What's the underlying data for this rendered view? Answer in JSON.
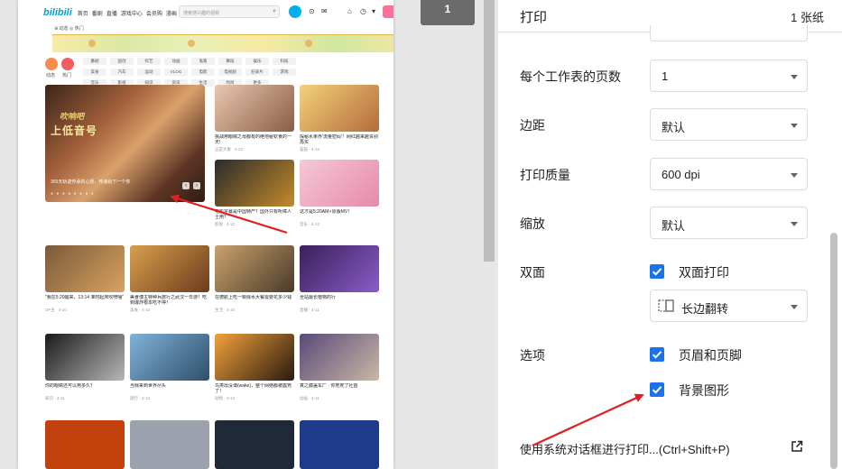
{
  "preview": {
    "page_number": "1",
    "site": {
      "logo": "bilibili",
      "nav": [
        "首页",
        "番剧",
        "直播",
        "游戏中心",
        "会员购",
        "漫画",
        "赛事"
      ],
      "search_placeholder": "搜索感兴趣的视频",
      "subnav": "⊕ 动态  ◎ 热门",
      "categories": [
        {
          "label": "动态",
          "color": "#f98b4b"
        },
        {
          "label": "热门",
          "color": "#f25d5d"
        }
      ],
      "tags": [
        "番剧",
        "国创",
        "综艺",
        "动画",
        "鬼畜",
        "舞蹈",
        "娱乐",
        "科技",
        "美食",
        "汽车",
        "运动",
        "VLOG",
        "电影",
        "电视剧",
        "纪录片",
        "游戏",
        "音乐",
        "影视",
        "知识",
        "资讯",
        "生活",
        "时尚",
        "更多"
      ],
      "hero": {
        "badge_text": "吹响吧",
        "title_text": "上低音号",
        "caption": "365天轨迹传承的心愿，传递给下一个你"
      },
      "cards": [
        {
          "title": "挑战用眼睛之母都有的绝地秘钦食的一天!",
          "meta": "这是大象 · 4-12"
        },
        {
          "title": "探秘水果界'流量密码'！网红越来越贵别再买",
          "meta": "猫猫 · 4-12"
        },
        {
          "title": "电影字幕是中国特产？国外只有听障人士用？",
          "meta": "影视 · 4-12"
        },
        {
          "title": "这才是5:20AM⚡原版MV！",
          "meta": "音乐 · 4-12"
        },
        {
          "title": "\"我在5:20醒来，13:14 准时起床吹喷嚏\"",
          "meta": "UP主 · 4-10"
        },
        {
          "title": "美食博主特种兵旅行之武汉一日游！吃到爆炸根本吃不停！",
          "meta": "美食 · 4-10"
        },
        {
          "title": "在德航上吃一顿除水大餐需要花多少钱",
          "meta": "生活 · 4-10"
        },
        {
          "title": "全站最长植物的行",
          "meta": "直播 · 4-11"
        },
        {
          "title": "你的眼睛还可以用多久？",
          "meta": "知识 · 4-11"
        },
        {
          "title": "当我来到世界尽头",
          "meta": "旅行 · 4-13"
        },
        {
          "title": "鸟类出没谭(wake)，整个网络都被震死了！",
          "meta": "动物 · 4-13"
        },
        {
          "title": "真之膝盖车厂 · 你死死了社首",
          "meta": "动画 · 4-11"
        }
      ]
    }
  },
  "panel": {
    "title": "打印",
    "sheet_count": "1 张纸",
    "rows": {
      "pages_per_sheet": {
        "label": "每个工作表的页数",
        "value": "1"
      },
      "margins": {
        "label": "边距",
        "value": "默认"
      },
      "quality": {
        "label": "打印质量",
        "value": "600 dpi"
      },
      "scale": {
        "label": "缩放",
        "value": "默认"
      },
      "duplex": {
        "label": "双面",
        "checkbox_label": "双面打印",
        "checked": true,
        "flip_value": "长边翻转"
      },
      "options": {
        "label": "选项",
        "headers_footers": "页眉和页脚",
        "background_graphics": "背景图形"
      }
    },
    "system_dialog": "使用系统对话框进行打印...(Ctrl+Shift+P)"
  },
  "colors": {
    "accent": "#1a73e8",
    "annotation_arrow": "#e02020"
  },
  "icons": {
    "external": "open-in-new-icon",
    "flip": "long-edge-flip-icon",
    "dropdown": "dropdown-arrow-icon"
  }
}
